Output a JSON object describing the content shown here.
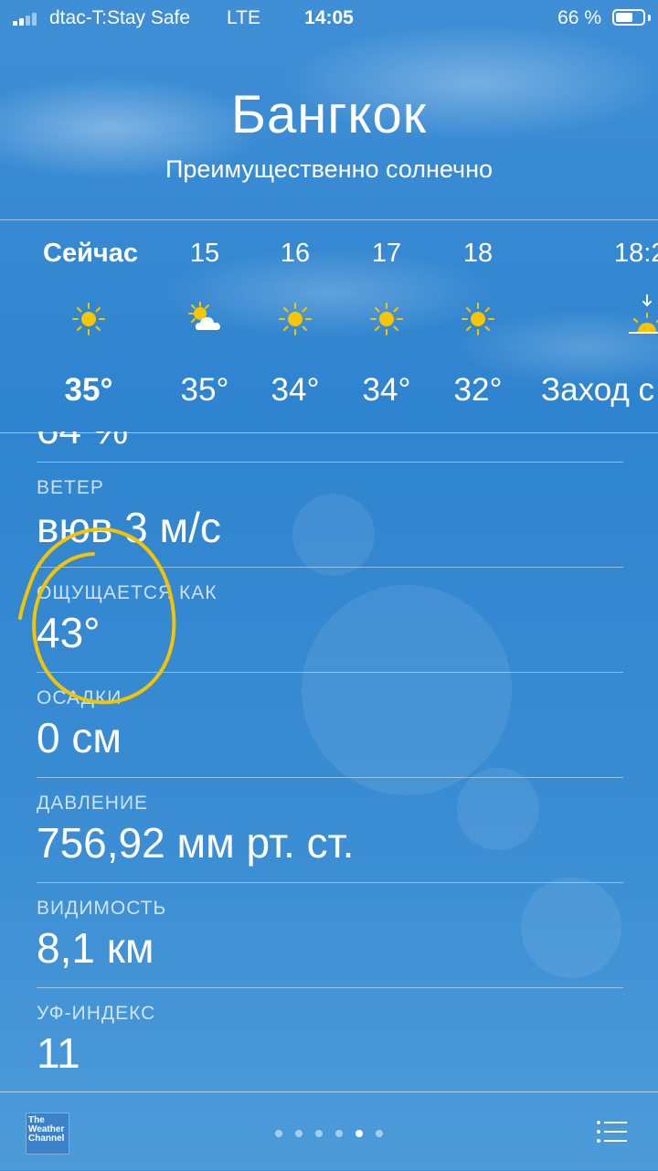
{
  "status_bar": {
    "carrier": "dtac-T:Stay Safe",
    "network": "LTE",
    "time": "14:05",
    "battery": "66 %",
    "battery_level": 0.66
  },
  "location": {
    "city": "Бангкок",
    "condition": "Преимущественно солнечно"
  },
  "hourly": [
    {
      "time": "Сейчас",
      "icon": "sun-icon",
      "temp": "35°"
    },
    {
      "time": "15",
      "icon": "sun-cloud-icon",
      "temp": "35°"
    },
    {
      "time": "16",
      "icon": "sun-icon",
      "temp": "34°"
    },
    {
      "time": "17",
      "icon": "sun-icon",
      "temp": "34°"
    },
    {
      "time": "18",
      "icon": "sun-icon",
      "temp": "32°"
    },
    {
      "time": "18:2",
      "icon": "sunset-icon",
      "temp": "Заход с"
    }
  ],
  "details": {
    "partial_value": "64 %",
    "rows": [
      {
        "label": "ВЕТЕР",
        "value": "вюв 3 м/с"
      },
      {
        "label": "ОЩУЩАЕТСЯ КАК",
        "value": "43°"
      },
      {
        "label": "ОСАДКИ",
        "value": "0 см"
      },
      {
        "label": "ДАВЛЕНИЕ",
        "value": "756,92 мм рт. ст."
      },
      {
        "label": "ВИДИМОСТЬ",
        "value": "8,1 км"
      },
      {
        "label": "УФ-ИНДЕКС",
        "value": "11"
      }
    ]
  },
  "bottom_bar": {
    "logo_text": "The Weather Channel",
    "page_count": 6,
    "active_page": 5
  },
  "colors": {
    "background": "#2f84cf",
    "sun": "#f7c600",
    "annotation": "#f5c400"
  }
}
